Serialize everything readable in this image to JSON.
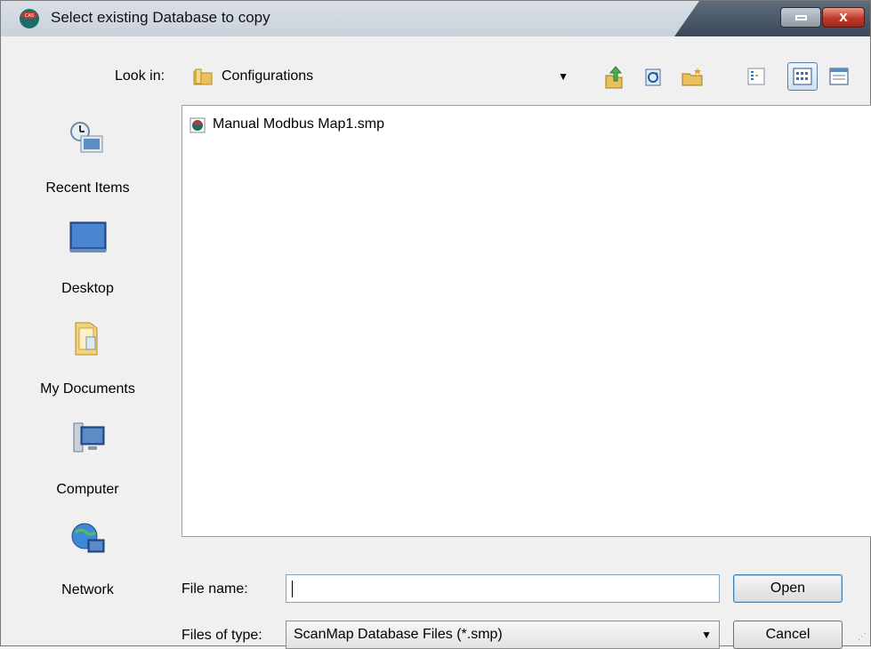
{
  "window": {
    "title": "Select existing Database to copy",
    "close_glyph": "x"
  },
  "lookin": {
    "label": "Look in:",
    "value": "Configurations",
    "arrow": "▼"
  },
  "toolbar": {
    "icons": [
      "up-one-level-icon",
      "refresh-icon",
      "new-folder-icon",
      "view-list-icon",
      "view-menu-icon",
      "details-icon"
    ]
  },
  "places": [
    {
      "label": "Recent Items",
      "icon": "recent-items-icon"
    },
    {
      "label": "Desktop",
      "icon": "desktop-icon"
    },
    {
      "label": "My Documents",
      "icon": "my-documents-icon"
    },
    {
      "label": "Computer",
      "icon": "computer-icon"
    },
    {
      "label": "Network",
      "icon": "network-icon"
    }
  ],
  "files": [
    {
      "name": "Manual Modbus Map1.smp",
      "icon": "smp-file-icon"
    }
  ],
  "filename": {
    "label": "File name:",
    "value": ""
  },
  "filetype": {
    "label": "Files of type:",
    "value": "ScanMap Database Files (*.smp)",
    "arrow": "▼"
  },
  "buttons": {
    "open": "Open",
    "cancel": "Cancel"
  },
  "colors": {
    "close": "#c0392b",
    "list_bg": "#ffffff",
    "window_bg": "#f0f0f0"
  }
}
